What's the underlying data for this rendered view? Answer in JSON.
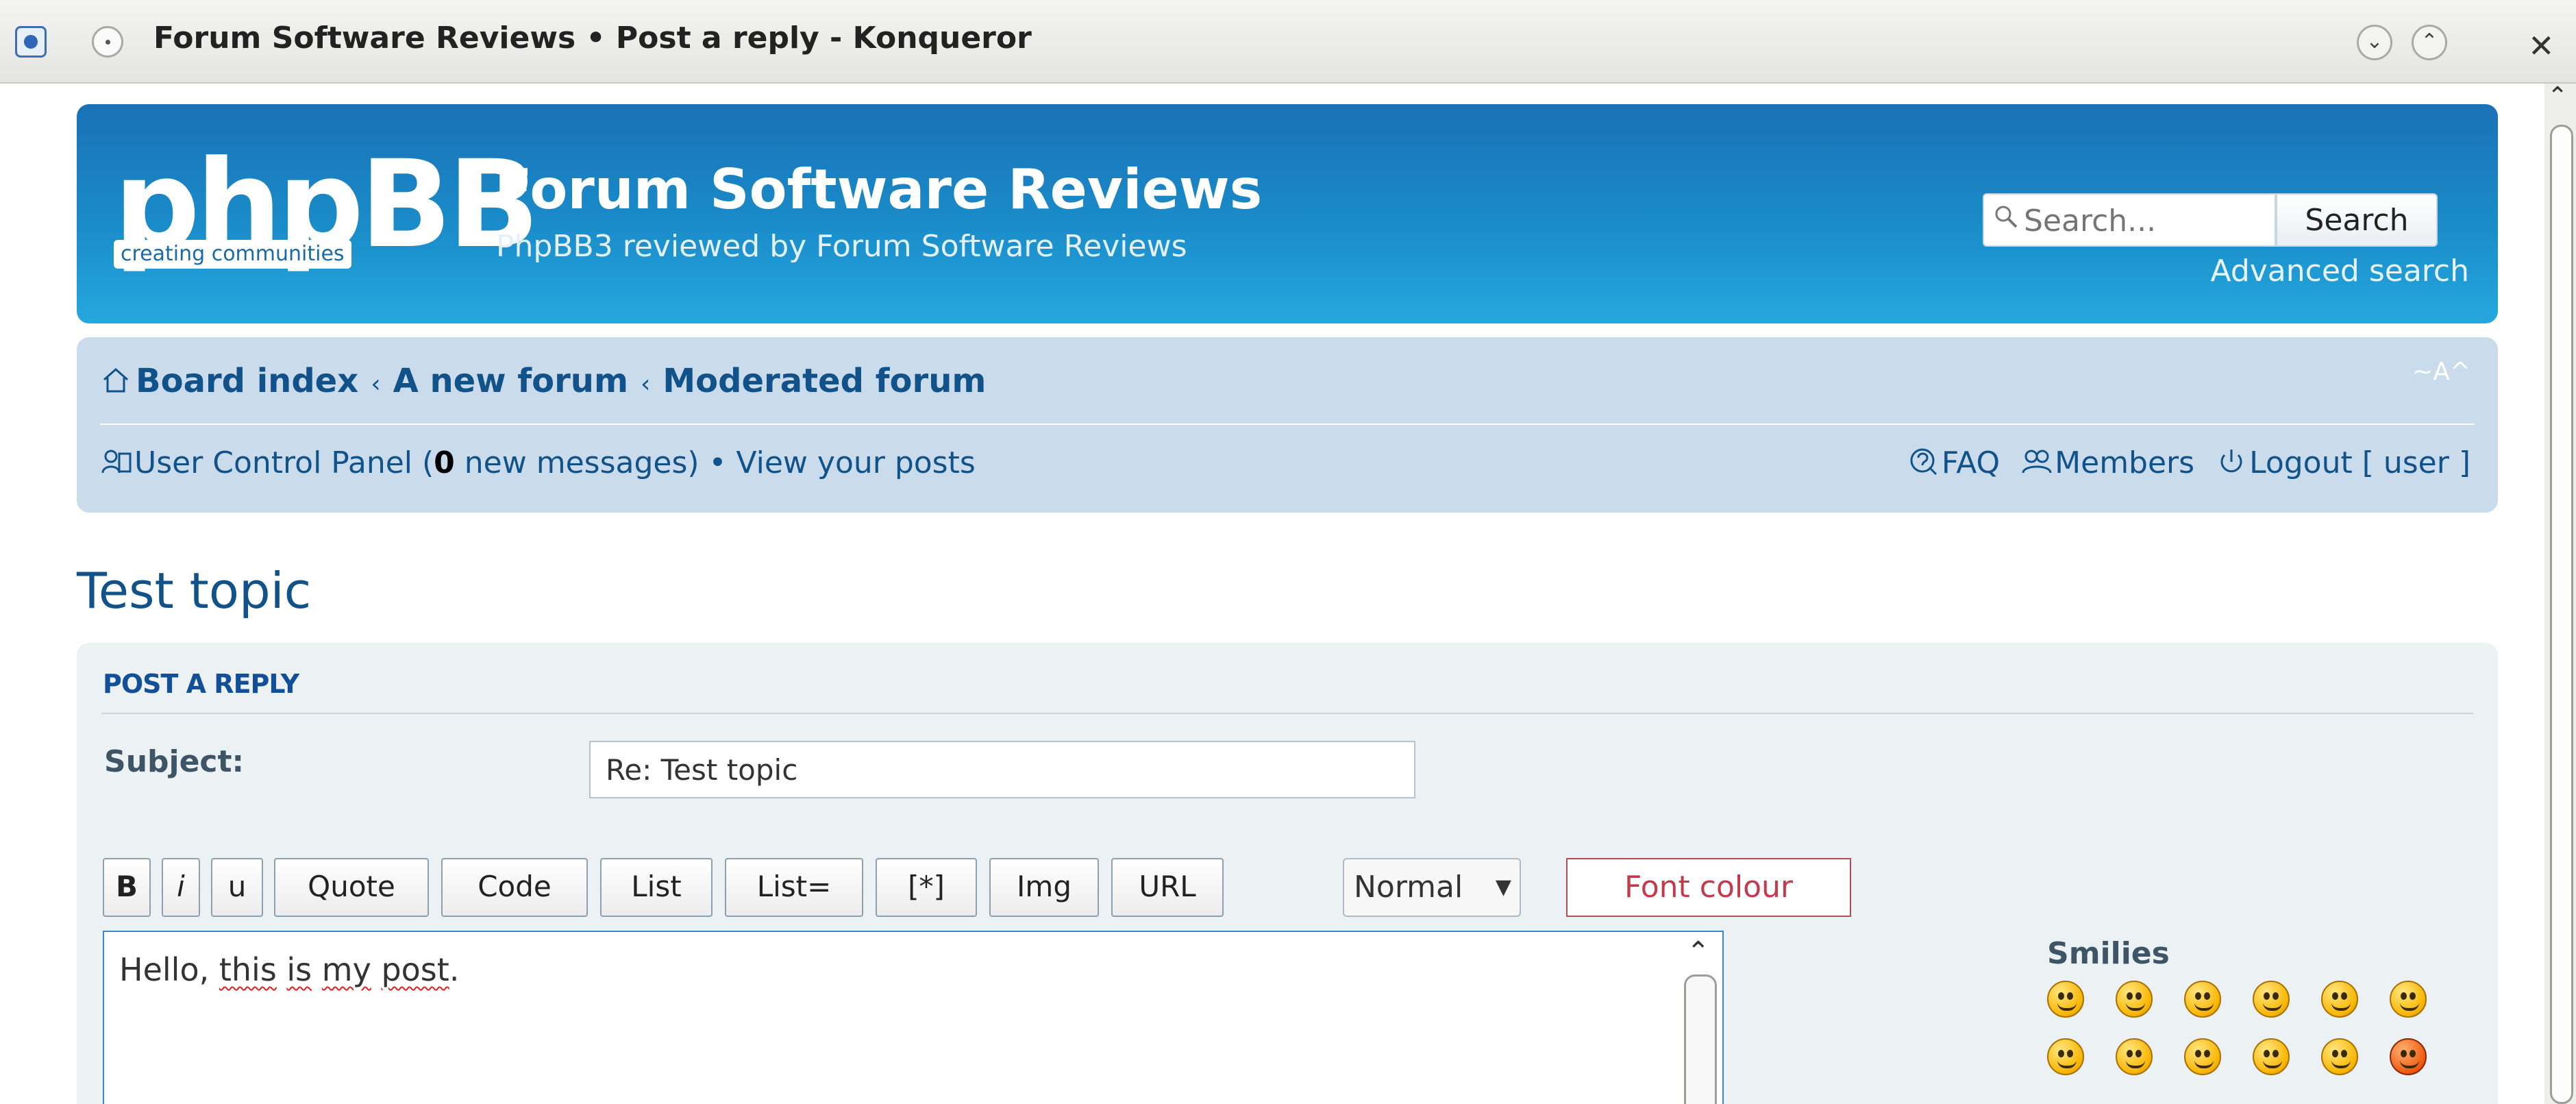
{
  "window": {
    "title": "Forum Software Reviews • Post a reply - Konqueror"
  },
  "header": {
    "logo_main": "phpBB",
    "logo_tagline": "creating  communities",
    "site_title": "Forum Software Reviews",
    "site_description": "PhpBB3 reviewed by Forum Software Reviews",
    "search": {
      "placeholder": "Search...",
      "button_label": "Search",
      "advanced_link": "Advanced search"
    }
  },
  "navbar": {
    "breadcrumbs": [
      "Board index",
      "A new forum",
      "Moderated forum"
    ],
    "font_resize": "~A^",
    "ucp_label": "User Control Panel (",
    "new_messages_count": "0",
    "new_messages_suffix": " new messages)",
    "bullet": "•",
    "view_posts": "View your posts",
    "faq": "FAQ",
    "members": "Members",
    "logout": "Logout [ user ]"
  },
  "topic": {
    "title": "Test topic"
  },
  "post_form": {
    "heading": "POST A REPLY",
    "subject_label": "Subject:",
    "subject_value": "Re: Test topic",
    "toolbar": {
      "bold": "B",
      "italic": "i",
      "underline": "u",
      "quote": "Quote",
      "code": "Code",
      "list": "List",
      "list_ordered": "List=",
      "list_item": "[*]",
      "img": "Img",
      "url": "URL",
      "font_size_selected": "Normal",
      "font_colour": "Font colour"
    },
    "message_text": {
      "part1": "Hello, ",
      "w1": "this",
      "s1": " ",
      "w2": "is",
      "s2": " ",
      "w3": "my",
      "s3": " ",
      "w4": "post",
      "end": "."
    },
    "smilies_heading": "Smilies",
    "smilies": [
      "very-happy-icon",
      "smile-icon",
      "wink-icon",
      "sad-icon",
      "surprised-icon",
      "shocked-icon",
      "confused-icon",
      "cool-icon",
      "laughing-icon",
      "mad-icon",
      "razz-icon",
      "evil-icon"
    ]
  },
  "colors": {
    "header_gradient_top": "#1a71b6",
    "header_gradient_bottom": "#25a8de",
    "navbar_bg": "#cadceb",
    "link": "#105289",
    "panel_bg": "#ecf1f3",
    "font_colour_accent": "#c4394c"
  }
}
